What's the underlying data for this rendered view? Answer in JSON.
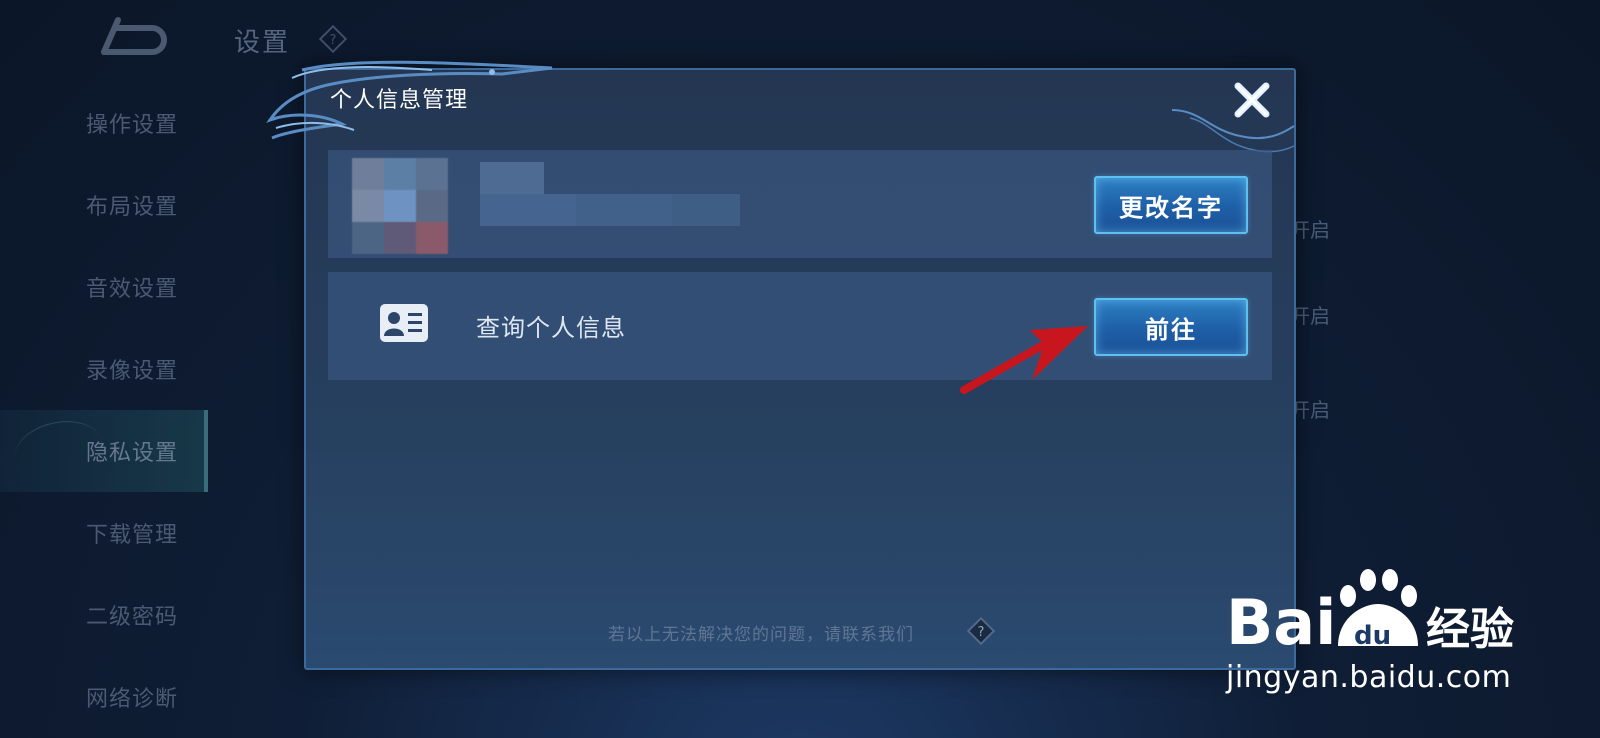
{
  "background": {
    "title": "设置",
    "sidebar_items": [
      {
        "label": "操作设置",
        "active": false
      },
      {
        "label": "布局设置",
        "active": false
      },
      {
        "label": "音效设置",
        "active": false
      },
      {
        "label": "录像设置",
        "active": false
      },
      {
        "label": "隐私设置",
        "active": true
      },
      {
        "label": "下载管理",
        "active": false
      },
      {
        "label": "二级密码",
        "active": false
      },
      {
        "label": "网络诊断",
        "active": false
      }
    ],
    "partial_right_text": [
      "开启",
      "开启",
      "开启"
    ]
  },
  "modal": {
    "title": "个人信息管理",
    "rename_button": "更改名字",
    "query_label": "查询个人信息",
    "go_button": "前往",
    "footer_note": "若以上无法解决您的问题，请联系我们"
  },
  "watermark": {
    "brand": "Baidu经验",
    "url": "jingyan.baidu.com"
  },
  "icons": {
    "back": "back-arrow-icon",
    "help": "question-diamond-icon",
    "close": "close-x-icon",
    "id_card": "id-card-icon",
    "annotation": "red-arrow"
  },
  "colors": {
    "accent_button_border": "#5cc0f0",
    "annotation_arrow": "#c8161e"
  }
}
